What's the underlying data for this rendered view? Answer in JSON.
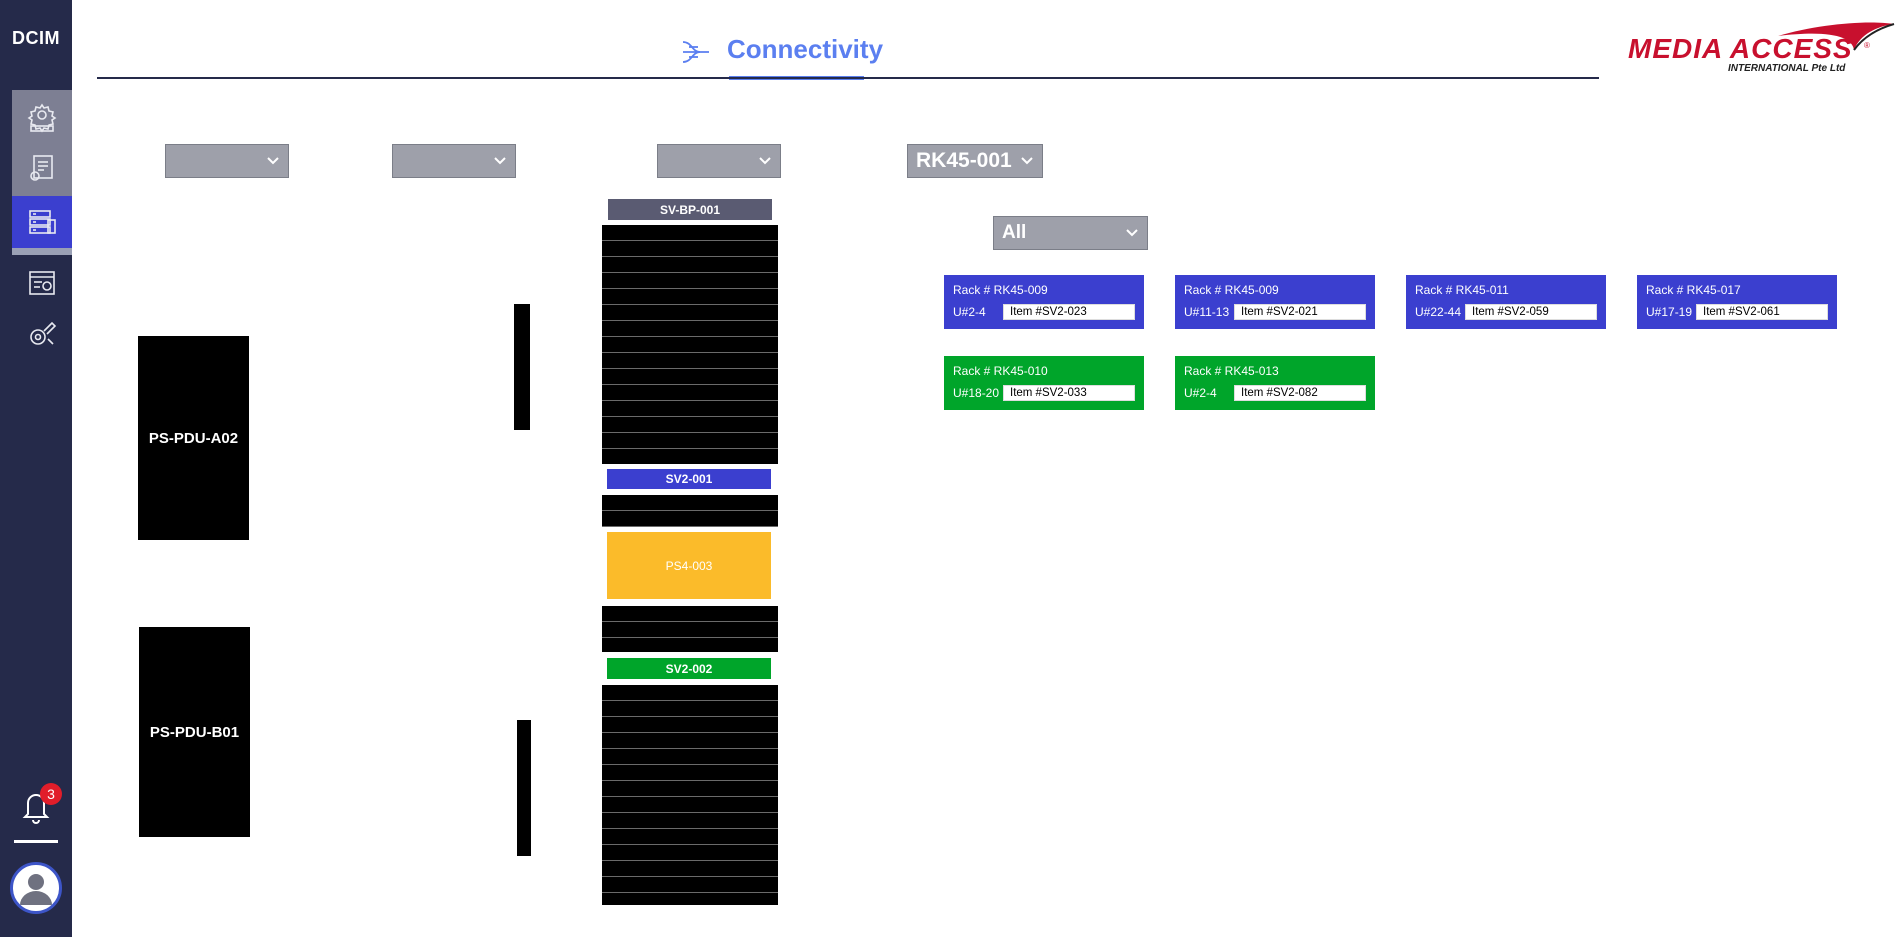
{
  "app": {
    "logo_text": "DCIM"
  },
  "header": {
    "title": "Connectivity",
    "brand": {
      "name_line1": "MEDIA ACCESS",
      "name_line2": "INTERNATIONAL Pte Ltd",
      "reg_mark": "®"
    }
  },
  "sidebar": {
    "items": [
      {
        "icon": "gear-settings-icon"
      },
      {
        "icon": "document-settings-icon"
      },
      {
        "icon": "server-stack-icon",
        "active": true
      },
      {
        "icon": "network-dashboard-icon"
      },
      {
        "icon": "tools-icon"
      }
    ],
    "notifications": {
      "icon": "bell-icon",
      "count": "3"
    },
    "user": {
      "icon": "avatar-icon"
    }
  },
  "filters": {
    "dropdown1": {
      "value": ""
    },
    "dropdown2": {
      "value": ""
    },
    "dropdown3": {
      "value": ""
    },
    "rack_select": {
      "value": "RK45-001"
    },
    "type_select": {
      "value": "All"
    }
  },
  "pdus": [
    {
      "label": "PS-PDU-A02"
    },
    {
      "label": "PS-PDU-B01"
    }
  ],
  "rack": {
    "top_label": "SV-BP-001",
    "slots": [
      {
        "label": "SV2-001",
        "color": "#3b3fcf"
      },
      {
        "label": "PS4-003",
        "color": "#fbbb2a"
      },
      {
        "label": "SV2-002",
        "color": "#00a52a"
      }
    ]
  },
  "connections": [
    {
      "rack": "Rack # RK45-009",
      "u": "U#2-4",
      "item": "Item #SV2-023",
      "color": "#3b3fcf"
    },
    {
      "rack": "Rack # RK45-009",
      "u": "U#11-13",
      "item": "Item #SV2-021",
      "color": "#3b3fcf"
    },
    {
      "rack": "Rack # RK45-011",
      "u": "U#22-44",
      "item": "Item #SV2-059",
      "color": "#3b3fcf"
    },
    {
      "rack": "Rack # RK45-017",
      "u": "U#17-19",
      "item": "Item #SV2-061",
      "color": "#3b3fcf"
    },
    {
      "rack": "Rack # RK45-010",
      "u": "U#18-20",
      "item": "Item #SV2-033",
      "color": "#00a52a"
    },
    {
      "rack": "Rack # RK45-013",
      "u": "U#2-4",
      "item": "Item #SV2-082",
      "color": "#00a52a"
    }
  ]
}
